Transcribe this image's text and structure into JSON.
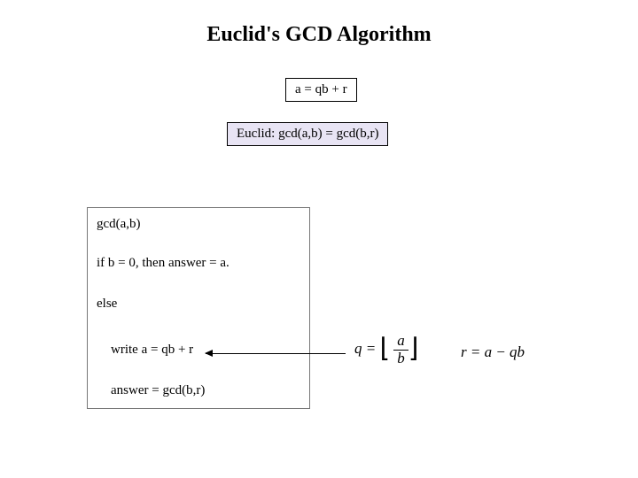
{
  "title": "Euclid's GCD Algorithm",
  "divisionBox": "a = qb + r",
  "euclidBox": "Euclid: gcd(a,b) = gcd(b,r)",
  "algo": {
    "l1": "gcd(a,b)",
    "l2": "if b = 0, then answer = a.",
    "l3": "else",
    "l4": "write a = qb + r",
    "l5": "answer = gcd(b,r)"
  },
  "formulas": {
    "q_lhs": "q = ",
    "q_num": "a",
    "q_den": "b",
    "r": "r = a − qb"
  }
}
